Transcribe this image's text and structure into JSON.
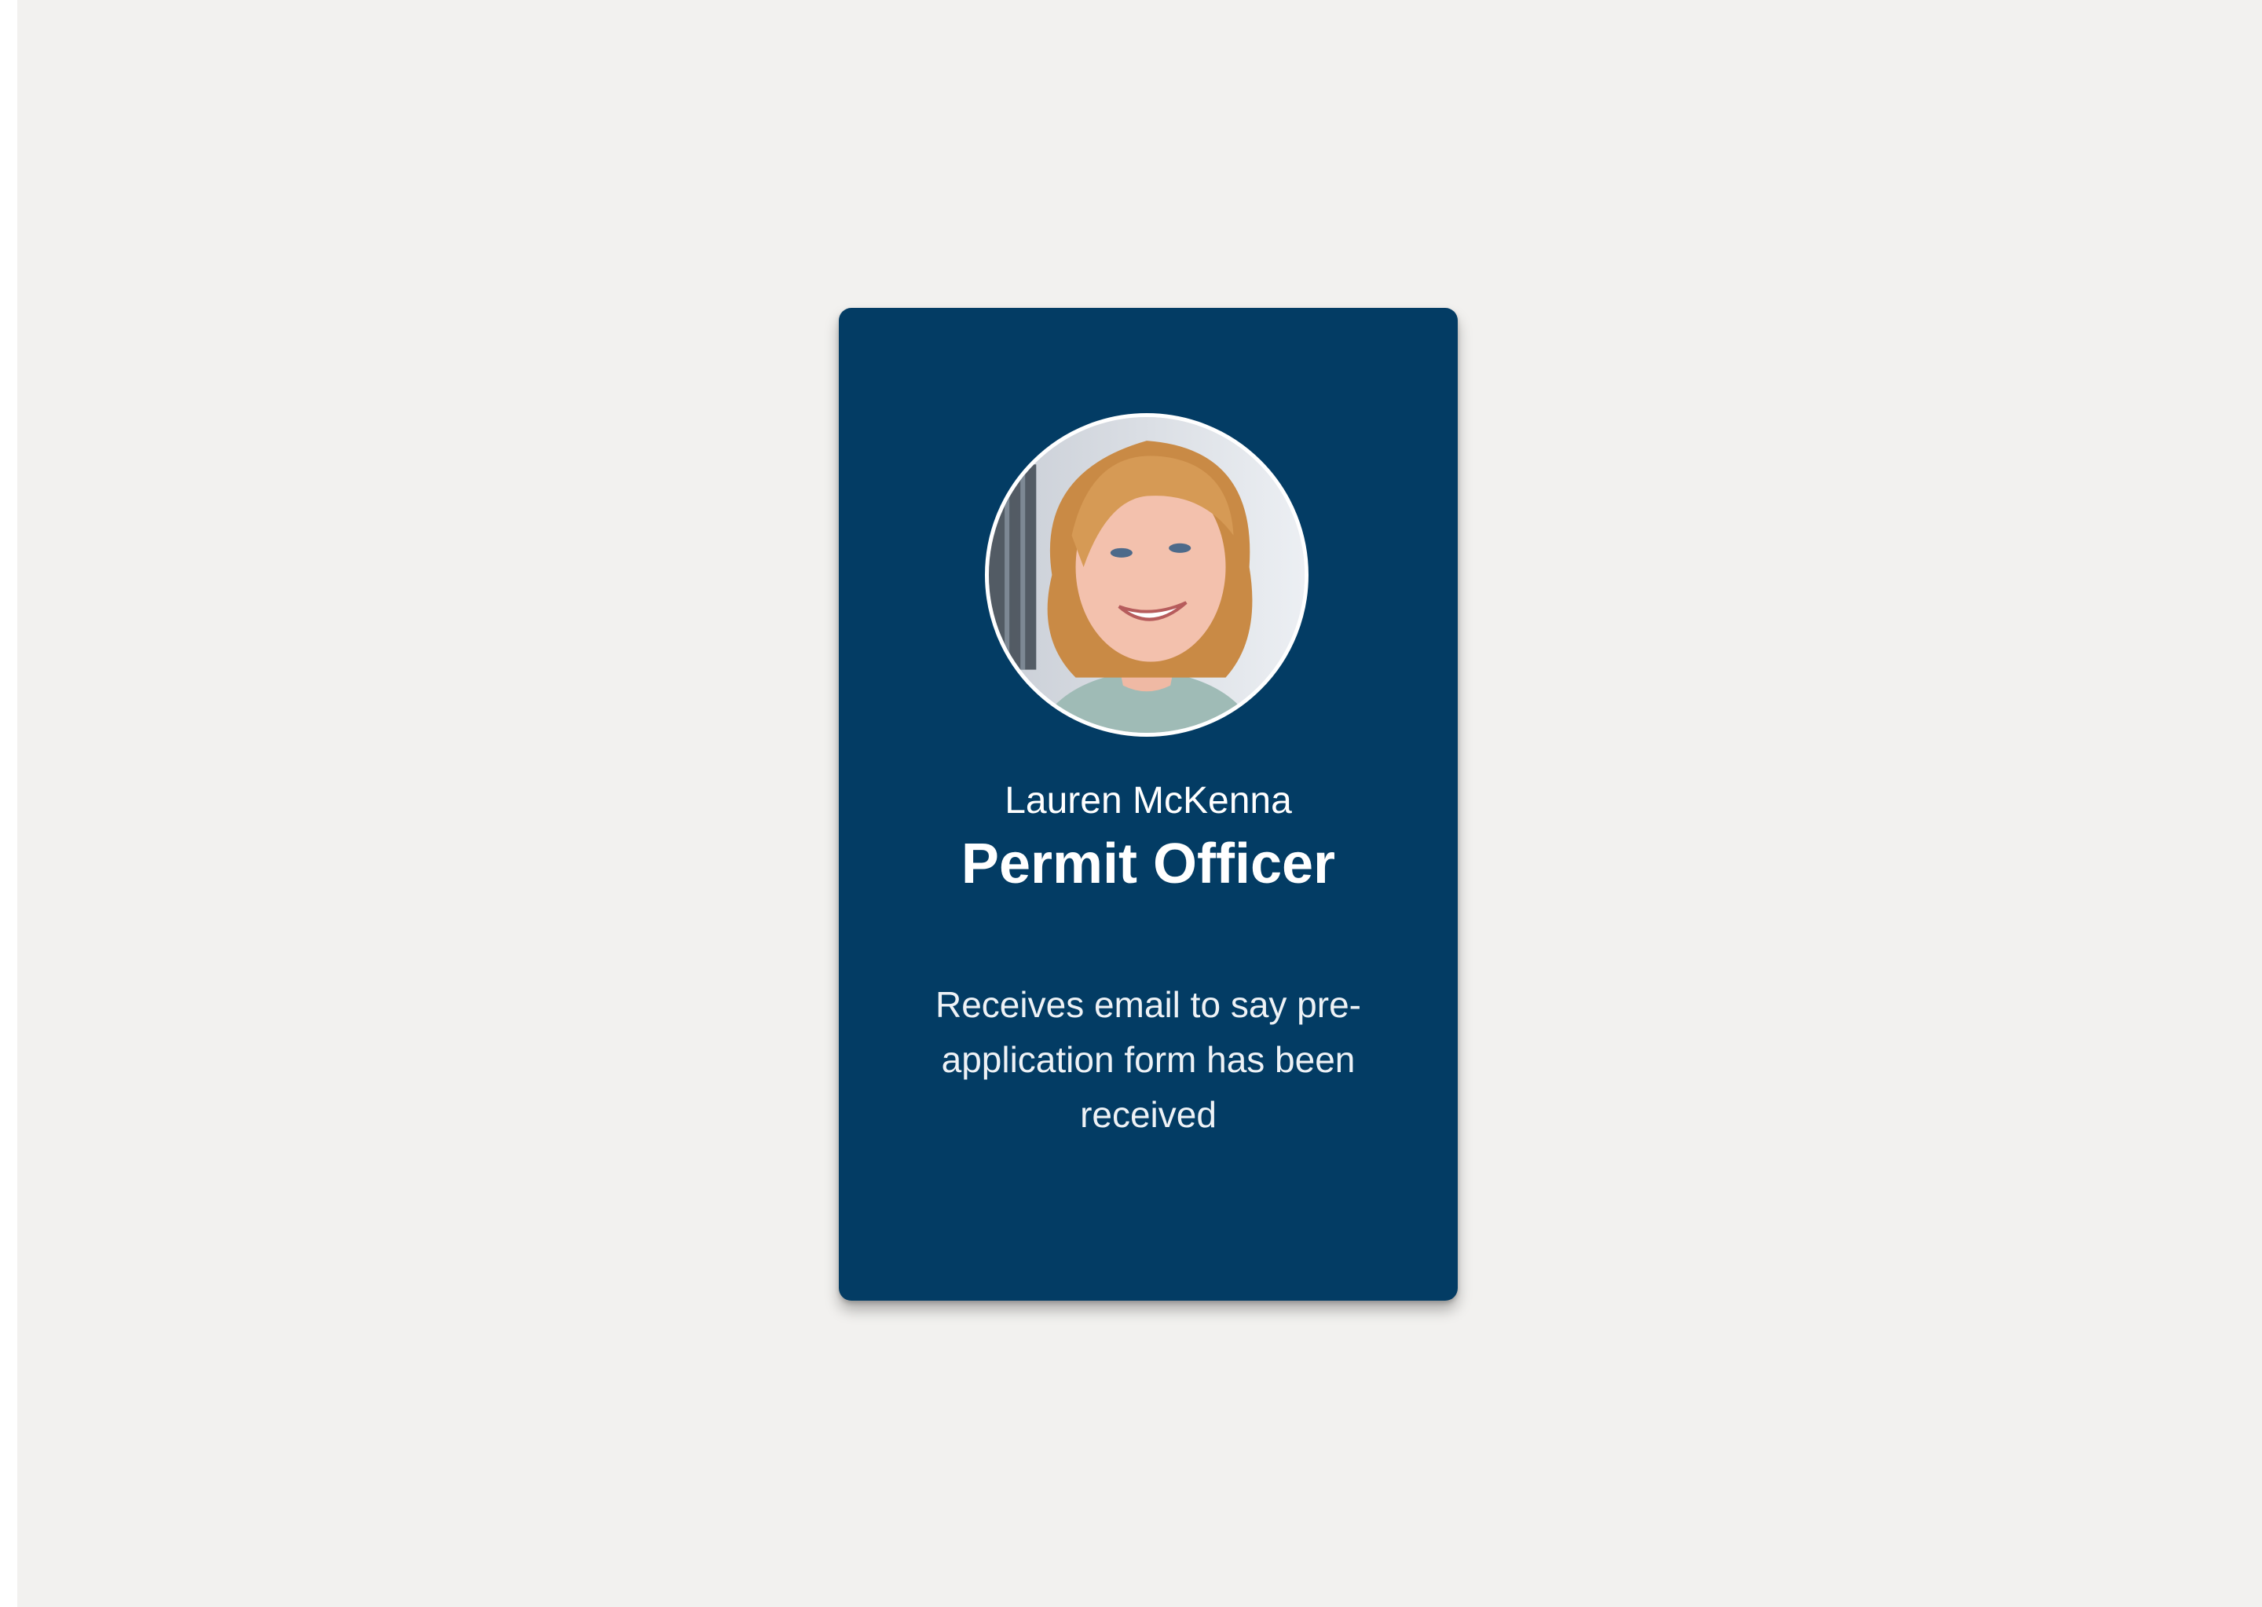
{
  "persona_card": {
    "name": "Lauren McKenna",
    "role": "Permit Officer",
    "description": "Receives email to say pre-application form has been received",
    "avatar_icon": "person-photo",
    "background_color": "#033c64",
    "page_background": "#f2f1ef"
  }
}
